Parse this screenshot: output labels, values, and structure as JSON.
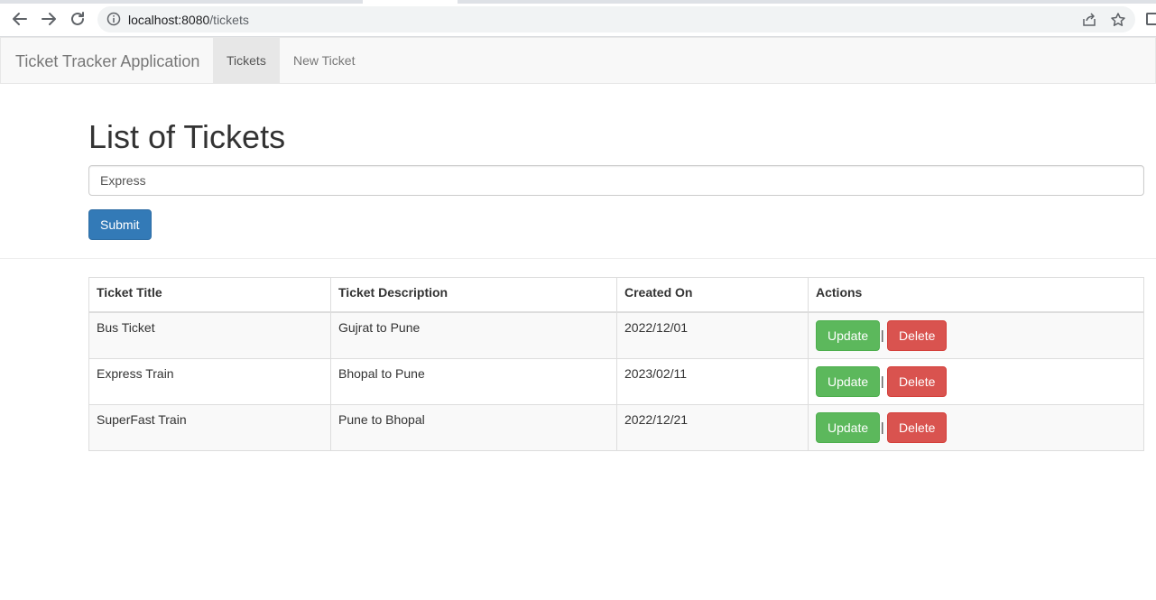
{
  "browser": {
    "url_host": "localhost:8080",
    "url_path": "/tickets"
  },
  "navbar": {
    "brand": "Ticket Tracker Application",
    "items": [
      {
        "label": "Tickets",
        "active": true
      },
      {
        "label": "New Ticket",
        "active": false
      }
    ]
  },
  "main": {
    "title": "List of Tickets",
    "search": {
      "value": "Express"
    },
    "submit_label": "Submit"
  },
  "table": {
    "headers": [
      "Ticket Title",
      "Ticket Description",
      "Created On",
      "Actions"
    ],
    "rows": [
      {
        "title": "Bus Ticket",
        "description": "Gujrat to Pune",
        "created_on": "2022/12/01"
      },
      {
        "title": "Express Train",
        "description": "Bhopal to Pune",
        "created_on": "2023/02/11"
      },
      {
        "title": "SuperFast Train",
        "description": "Pune to Bhopal",
        "created_on": "2022/12/21"
      }
    ],
    "update_label": "Update",
    "delete_label": "Delete",
    "separator": "|"
  },
  "colors": {
    "primary": "#337ab7",
    "success": "#5cb85c",
    "danger": "#d9534f"
  }
}
